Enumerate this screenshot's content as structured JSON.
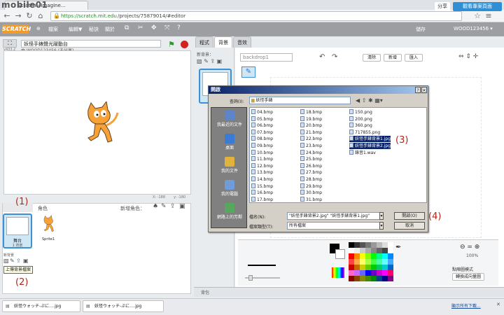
{
  "browser": {
    "tab_title": "Scratch - Imagine...",
    "url_host": "https://scratch.mit.edu",
    "url_path": "/projects/75879014/#editor",
    "back_icon": "back-arrow-icon",
    "forward_icon": "forward-arrow-icon",
    "reload_icon": "reload-icon",
    "home_icon": "home-icon",
    "watermark": "mobile01"
  },
  "scratch": {
    "logo": "SCRATCH",
    "menus": [
      "檔案",
      "編輯▼",
      "秘訣",
      "關於"
    ],
    "save": "儲存",
    "user": "WOOD123456 ▾",
    "share": "分享",
    "see_project": "觀看專案頁面"
  },
  "project": {
    "title": "妖怪手錶聲光躍動台",
    "by": "由 WOOD123456 (未分享)",
    "version": "v433.2",
    "coords_x": "X: -188",
    "coords_y": "y: -180"
  },
  "sprites": {
    "header": "角色",
    "new_sprite": "新增角色：",
    "stage_label": "舞台",
    "stage_sub": "1 背景",
    "sprite1": "Sprite1",
    "new_backdrop": "新背景",
    "tooltip": "上傳背景檔案"
  },
  "editor": {
    "tabs": [
      "程式",
      "背景",
      "音效"
    ],
    "new_backdrop_label": "新背景：",
    "backdrop_name": "backdrop1",
    "clear": "清除",
    "add": "新增",
    "import": "匯入",
    "zoom_level": "100%",
    "bitmap_mode": "點陣圖模式",
    "convert_vector": "轉換成向量圖",
    "bottom_label": "背包"
  },
  "dialog": {
    "title": "開啟",
    "lookin_label": "查詢(I):",
    "lookin_value": "妖怪手錶",
    "left": [
      "我最近的文件",
      "桌面",
      "我的文件",
      "我的電腦",
      "網路上的芳鄰"
    ],
    "col1": [
      "04.bmp",
      "05.bmp",
      "06.bmp",
      "07.bmp",
      "08.bmp",
      "09.bmp",
      "10.bmp",
      "11.bmp",
      "12.bmp",
      "13.bmp",
      "14.bmp",
      "15.bmp",
      "16.bmp",
      "17.bmp"
    ],
    "col2": [
      "18.bmp",
      "19.bmp",
      "20.bmp",
      "21.bmp",
      "22.bmp",
      "23.bmp",
      "24.bmp",
      "25.bmp",
      "26.bmp",
      "27.bmp",
      "28.bmp",
      "29.bmp",
      "30.bmp",
      "31.bmp"
    ],
    "col3": [
      "150.png",
      "200.png",
      "360.png",
      "717855.png",
      "妖怪手錶背景1.jpg",
      "妖怪手錶背景2.jpg",
      "錄音1.wav"
    ],
    "filename_label": "檔名(N):",
    "filename_value": "\"妖怪手錶背景2.jpg\" \"妖怪手錶背景1.jpg\"",
    "filetype_label": "檔案類型(T):",
    "filetype_value": "所有檔案",
    "open": "開啟(O)",
    "cancel": "取消"
  },
  "annotations": [
    "(1)",
    "(2)",
    "(3)",
    "(4)"
  ],
  "taskbar": {
    "downloads": [
      "妖怪ウォッチ-ぷに….jpg",
      "妖怪ウォッチ-ぷに….jpg"
    ],
    "show_all": "顯示所有下載..."
  },
  "colors": {
    "scratch_orange": "#f19c2a",
    "share_blue": "#2f8fd4",
    "title_bar": "#0a246a",
    "annotation": "#b0241a"
  }
}
